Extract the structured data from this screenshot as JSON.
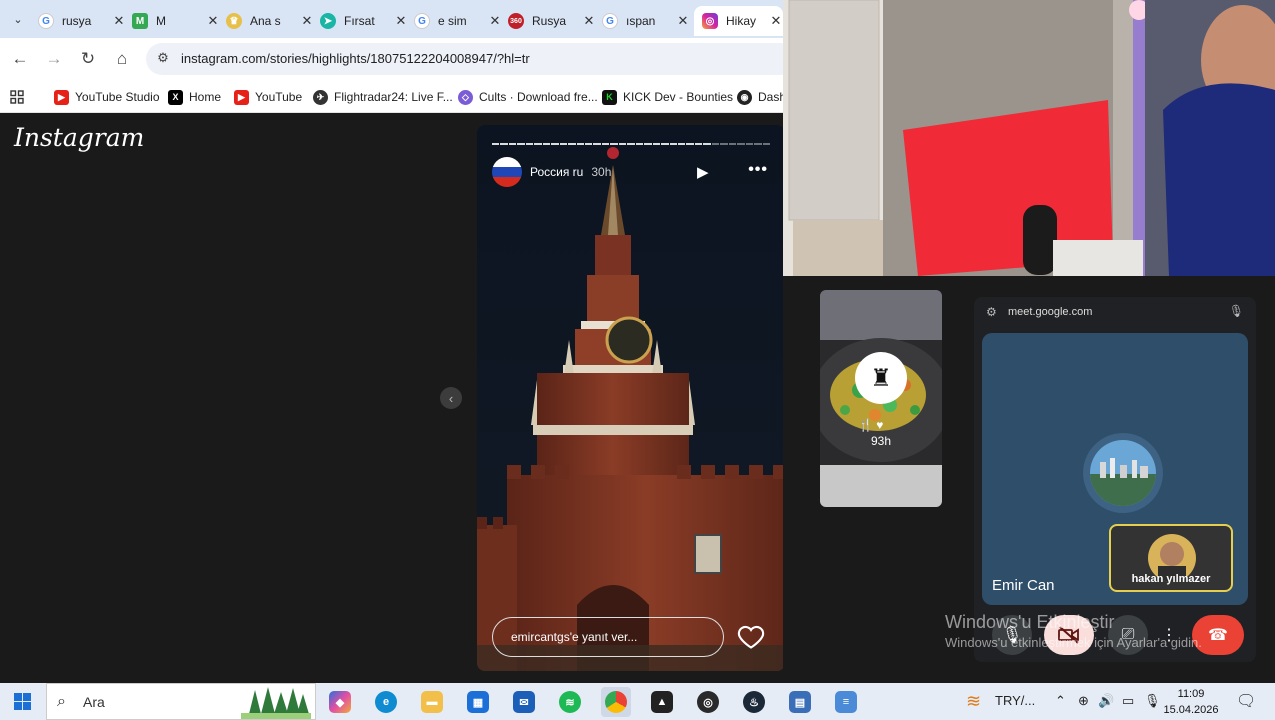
{
  "browser": {
    "tabs": [
      {
        "title": "rusya",
        "icon": "google-icon",
        "color": "#4285f4"
      },
      {
        "title": "M",
        "icon": "gmail-record-icon",
        "color": "#34a853"
      },
      {
        "title": "Ana s",
        "icon": "crown-icon",
        "color": "#c9a227"
      },
      {
        "title": "Fırsat",
        "icon": "arrow-icon",
        "color": "#19b5a5"
      },
      {
        "title": "e sim",
        "icon": "google-icon",
        "color": "#4285f4"
      },
      {
        "title": "Rusya",
        "icon": "360-icon",
        "color": "#c0202a"
      },
      {
        "title": "ıspan",
        "icon": "google-icon",
        "color": "#4285f4"
      },
      {
        "title": "Hikay",
        "icon": "instagram-icon",
        "color": "#d6249f"
      }
    ],
    "url": "instagram.com/stories/highlights/18075122204008947/?hl=tr",
    "bookmarks": [
      {
        "label": "YouTube Studio",
        "icon": "youtube-icon",
        "color": "#e62117"
      },
      {
        "label": "Home",
        "icon": "x-icon",
        "color": "#000000"
      },
      {
        "label": "YouTube",
        "icon": "youtube-icon",
        "color": "#e62117"
      },
      {
        "label": "Flightradar24: Live F...",
        "icon": "flightradar-icon",
        "color": "#333333"
      },
      {
        "label": "Cults · Download fre...",
        "icon": "cults-icon",
        "color": "#7b5cd6"
      },
      {
        "label": "KICK Dev - Bounties",
        "icon": "kick-icon",
        "color": "#1bd42a"
      },
      {
        "label": "Dash",
        "icon": "dash-icon",
        "color": "#222222"
      }
    ]
  },
  "instagram": {
    "logo": "Instagram",
    "story": {
      "username": "Россия ru",
      "time": "30h",
      "reply_placeholder": "emircantgs'e yanıt ver..."
    },
    "next_story_time": "93h"
  },
  "meet": {
    "domain": "meet.google.com",
    "participant": "Emir Can",
    "self_name": "hakan yılmazer"
  },
  "watermark": {
    "line1": "Windows'u Etkinleştir",
    "line2": "Windows'u etkinleştirmek için Ayarlar'a gidin."
  },
  "taskbar": {
    "search_placeholder": "Ara",
    "currency": "TRY/...",
    "time": "11:09",
    "date": "15.04.2026"
  }
}
